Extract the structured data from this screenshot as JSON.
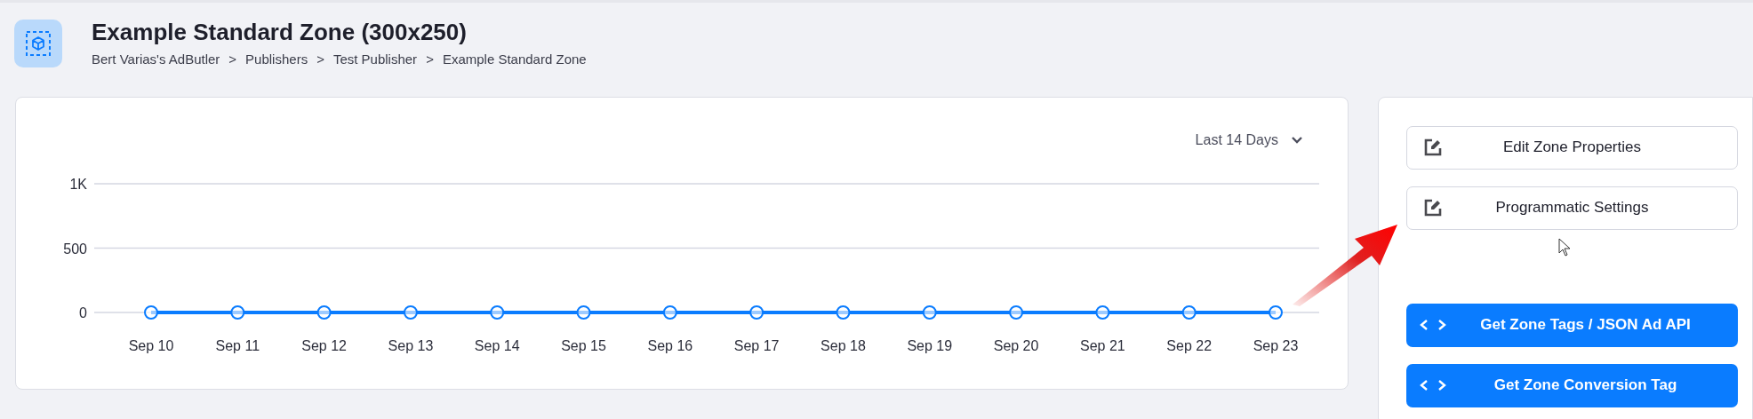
{
  "header": {
    "title": "Example Standard Zone (300x250)",
    "breadcrumb": [
      "Bert Varias's AdButler",
      "Publishers",
      "Test Publisher",
      "Example Standard Zone"
    ],
    "separator": ">"
  },
  "chart_panel": {
    "range": "Last 14 Days",
    "chart_data": {
      "type": "line",
      "categories": [
        "Sep 10",
        "Sep 11",
        "Sep 12",
        "Sep 13",
        "Sep 14",
        "Sep 15",
        "Sep 16",
        "Sep 17",
        "Sep 18",
        "Sep 19",
        "Sep 20",
        "Sep 21",
        "Sep 22",
        "Sep 23"
      ],
      "series": [
        {
          "color": "#0a7cff",
          "marker": "circle",
          "values": [
            0,
            0,
            0,
            0,
            0,
            0,
            0,
            0,
            0,
            0,
            0,
            0,
            0,
            0
          ]
        }
      ],
      "ylim": [
        0,
        1000
      ],
      "yticks": [
        0,
        500,
        {
          "value": 1000,
          "label": "1K"
        }
      ]
    }
  },
  "actions": [
    {
      "label": "Edit Zone Properties",
      "kind": "edit"
    },
    {
      "label": "Programmatic Settings",
      "kind": "edit"
    },
    {
      "label": "Get Zone Tags / JSON Ad API",
      "kind": "code"
    },
    {
      "label": "Get Zone Conversion Tag",
      "kind": "code"
    }
  ]
}
